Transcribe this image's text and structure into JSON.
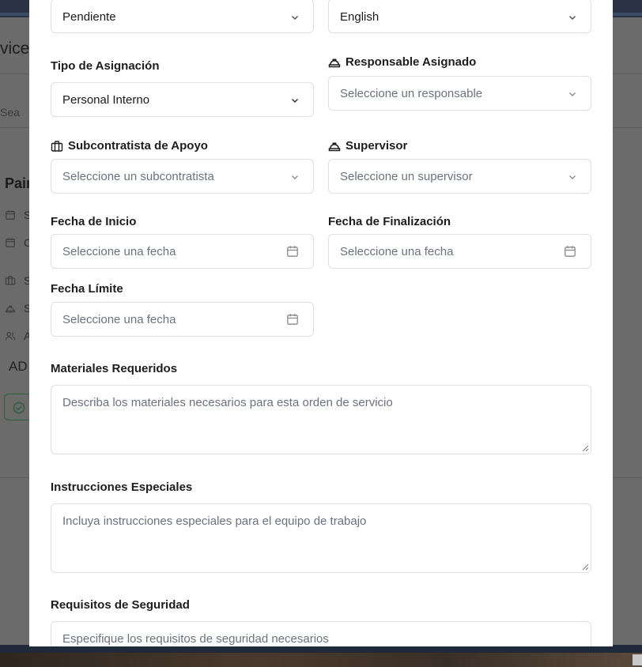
{
  "background_app": {
    "title_fragment": "vice",
    "search_fragment": "Sea",
    "item_fragment": "Pair",
    "row_letters": [
      "S",
      "C",
      "S",
      "S",
      "A"
    ],
    "code_fragment": "AD"
  },
  "form": {
    "top_partial": {
      "left_value": "Pendiente",
      "right_value": "English"
    },
    "assignment_type": {
      "label": "Tipo de Asignación",
      "value": "Personal Interno"
    },
    "responsible": {
      "label": "Responsable Asignado",
      "placeholder": "Seleccione un responsable",
      "icon": "hard-hat-icon"
    },
    "subcontractor": {
      "label": "Subcontratista de Apoyo",
      "placeholder": "Seleccione un subcontratista",
      "icon": "briefcase-icon"
    },
    "supervisor": {
      "label": "Supervisor",
      "placeholder": "Seleccione un supervisor",
      "icon": "hard-hat-icon"
    },
    "start_date": {
      "label": "Fecha de Inicio",
      "placeholder": "Seleccione una fecha"
    },
    "end_date": {
      "label": "Fecha de Finalización",
      "placeholder": "Seleccione una fecha"
    },
    "deadline": {
      "label": "Fecha Límite",
      "placeholder": "Seleccione una fecha"
    },
    "materials": {
      "label": "Materiales Requeridos",
      "placeholder": "Describa los materiales necesarios para esta orden de servicio"
    },
    "special_instructions": {
      "label": "Instrucciones Especiales",
      "placeholder": "Incluya instrucciones especiales para el equipo de trabajo"
    },
    "safety_requirements": {
      "label": "Requisitos de Seguridad",
      "placeholder": "Especifique los requisitos de seguridad necesarios"
    }
  },
  "colors": {
    "modal_bg": "#ffffff",
    "border": "#dcdfe4",
    "placeholder_text": "#6b7280",
    "overlay": "#6b6b6b",
    "top_bar": "#2a3346"
  }
}
